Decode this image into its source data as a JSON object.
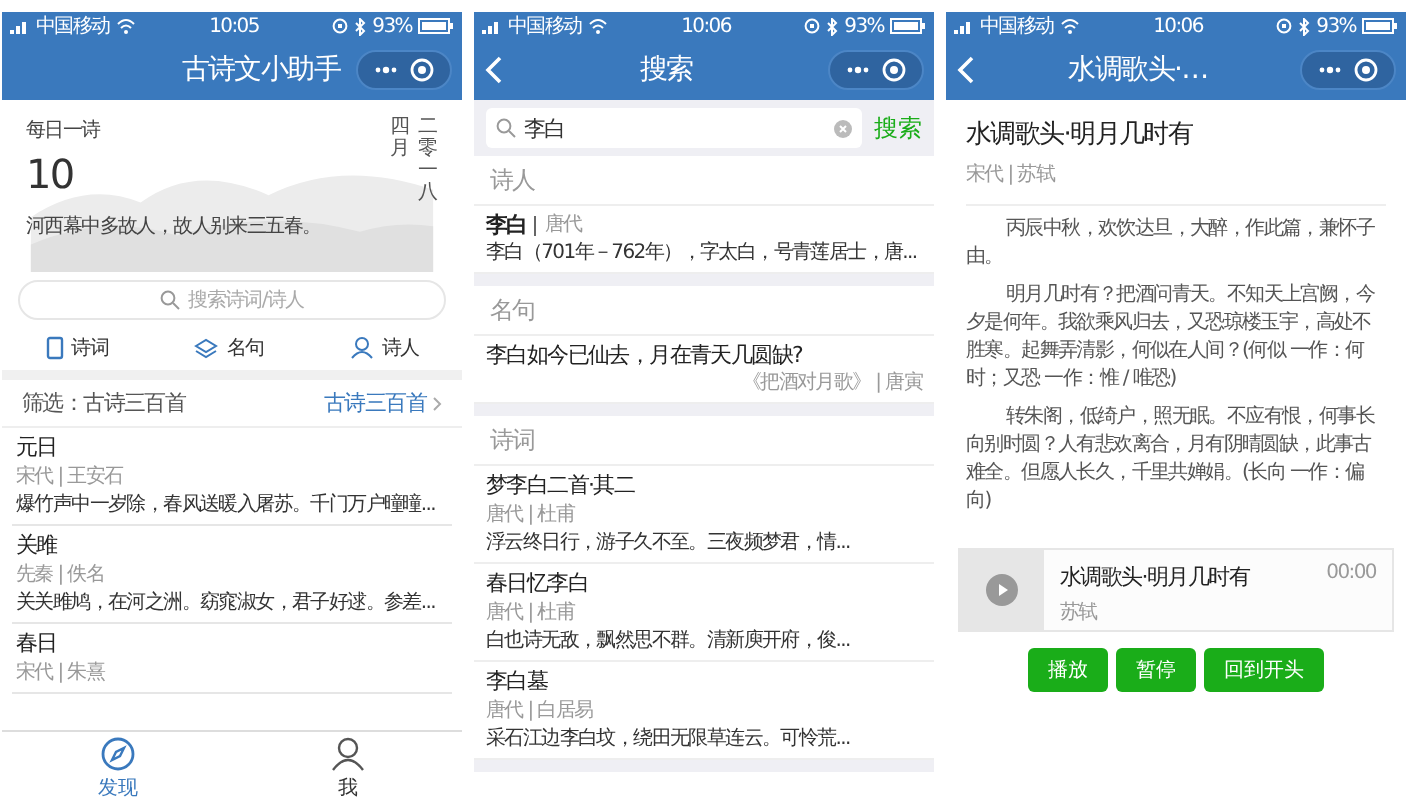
{
  "screens": [
    {
      "kind": "home",
      "status_bar": {
        "carrier": "中国移动",
        "time": "10:05",
        "battery": "93%"
      },
      "nav": {
        "title": "古诗文小助手",
        "back": false
      },
      "daily": {
        "label": "每日一诗",
        "day": "10",
        "month": "四月",
        "year": "二零一八",
        "verse": "河西幕中多故人，故人别来三五春。"
      },
      "search": {
        "placeholder": "搜索诗词/诗人"
      },
      "categories": [
        {
          "label": "诗词",
          "kind": "book"
        },
        {
          "label": "名句",
          "kind": "layers"
        },
        {
          "label": "诗人",
          "kind": "person"
        }
      ],
      "filter": {
        "label": "筛选：古诗三百首",
        "value": "古诗三百首"
      },
      "poems": [
        {
          "title": "元日",
          "meta": "宋代 | 王安石",
          "excerpt": "爆竹声中一岁除，春风送暖入屠苏。千门万户曈曈..."
        },
        {
          "title": "关雎",
          "meta": "先秦 | 佚名",
          "excerpt": "关关雎鸠，在河之洲。窈窕淑女，君子好逑。参差..."
        },
        {
          "title": "春日",
          "meta": "宋代 | 朱熹"
        }
      ],
      "tabbar": [
        {
          "label": "发现",
          "kind": "compass",
          "selected": true
        },
        {
          "label": "我",
          "kind": "person",
          "selected": false
        }
      ]
    },
    {
      "kind": "search",
      "status_bar": {
        "carrier": "中国移动",
        "time": "10:06",
        "battery": "93%"
      },
      "nav": {
        "title": "搜索",
        "back": true
      },
      "search": {
        "value": "李白",
        "button": "搜索"
      },
      "sections": [
        {
          "heading": "诗人",
          "kind": "poet",
          "items": [
            {
              "name": "李白",
              "era": "唐代",
              "text": "李白（701年－762年），字太白，号青莲居士，唐..."
            }
          ]
        },
        {
          "heading": "名句",
          "kind": "quote",
          "items": [
            {
              "text": "李白如今已仙去，月在青天几圆缺?",
              "source": "《把酒对月歌》 | 唐寅"
            }
          ]
        },
        {
          "heading": "诗词",
          "kind": "poem",
          "items": [
            {
              "title": "梦李白二首·其二",
              "meta": "唐代 | 杜甫",
              "excerpt": "浮云终日行，游子久不至。三夜频梦君，情..."
            },
            {
              "title": "春日忆李白",
              "meta": "唐代 | 杜甫",
              "excerpt": "白也诗无敌，飘然思不群。清新庾开府，俊..."
            },
            {
              "title": "李白墓",
              "meta": "唐代 | 白居易",
              "excerpt": "采石江边李白坟，绕田无限草连云。可怜荒..."
            }
          ]
        }
      ]
    },
    {
      "kind": "detail",
      "status_bar": {
        "carrier": "中国移动",
        "time": "10:06",
        "battery": "93%"
      },
      "nav": {
        "title": "水调歌头·…",
        "back": true
      },
      "title": "水调歌头·明月几时有",
      "meta": "宋代 | 苏轼",
      "paragraphs": [
        "丙辰中秋，欢饮达旦，大醉，作此篇，兼怀子由。",
        "明月几时有？把酒问青天。不知天上宫阙，今夕是何年。我欲乘风归去，又恐琼楼玉宇，高处不胜寒。起舞弄清影，何似在人间？(何似 一作：何时；又恐 一作：惟 / 唯恐)",
        "转朱阁，低绮户，照无眠。不应有恨，何事长向别时圆？人有悲欢离合，月有阴晴圆缺，此事古难全。但愿人长久，千里共婵娟。(长向 一作：偏向)"
      ],
      "player": {
        "title": "水调歌头·明月几时有",
        "author": "苏轼",
        "time": "00:00"
      },
      "buttons": [
        "播放",
        "暂停",
        "回到开头"
      ]
    }
  ]
}
